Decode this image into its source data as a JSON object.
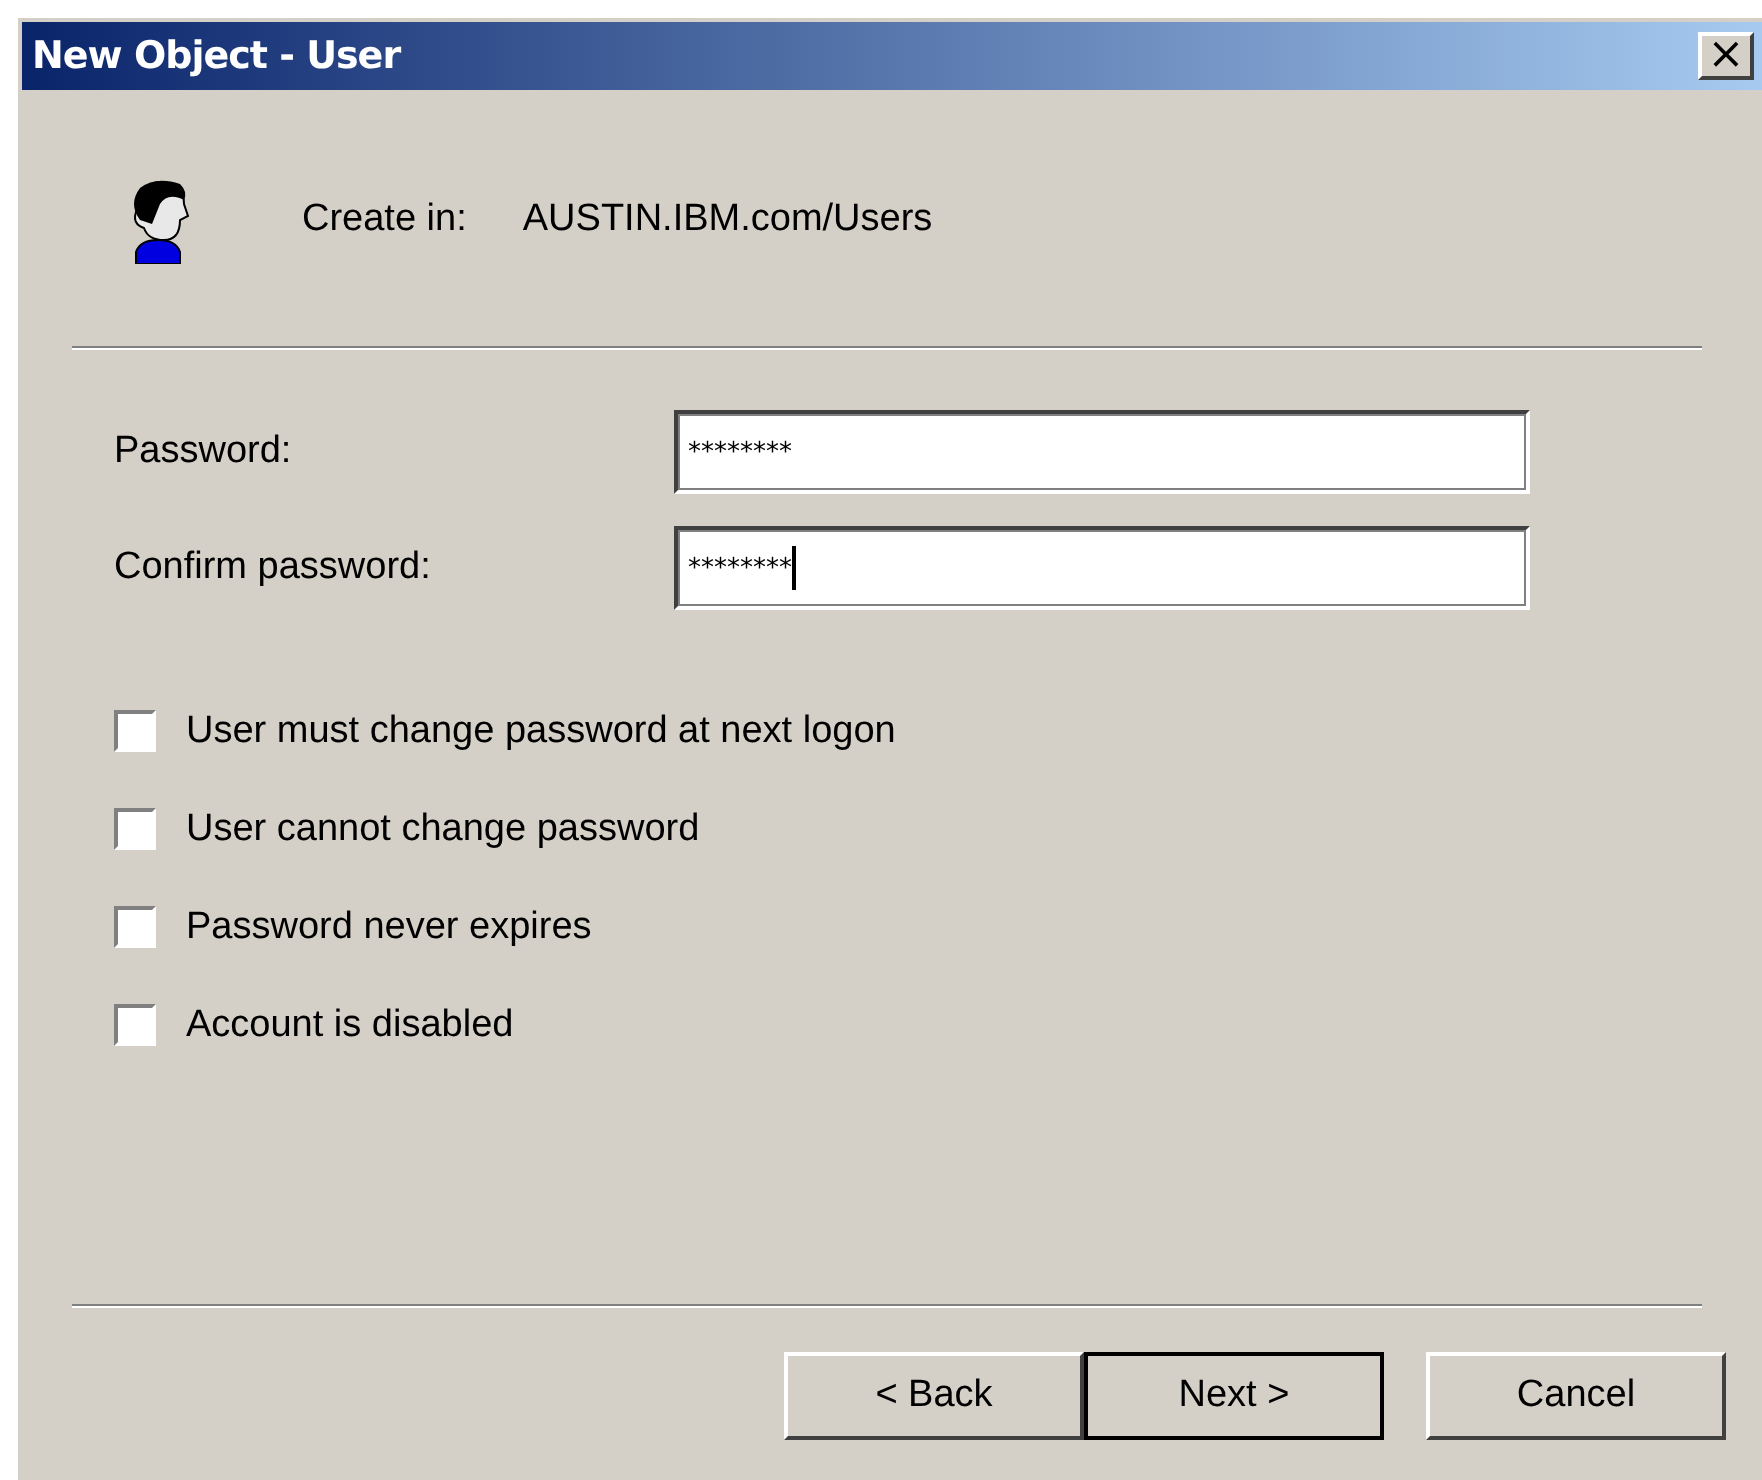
{
  "window": {
    "title": "New Object - User",
    "close": "×"
  },
  "header": {
    "label": "Create in:",
    "value": "AUSTIN.IBM.com/Users"
  },
  "fields": [
    {
      "label": "Password:",
      "value": "********",
      "focused": false
    },
    {
      "label": "Confirm password:",
      "value": "********",
      "focused": true
    }
  ],
  "options": [
    {
      "label": "User must change password at next logon",
      "checked": false
    },
    {
      "label": "User cannot change password",
      "checked": false
    },
    {
      "label": "Password never expires",
      "checked": false
    },
    {
      "label": "Account is disabled",
      "checked": false
    }
  ],
  "buttons": [
    {
      "label": "< Back",
      "default": false
    },
    {
      "label": "Next >",
      "default": true
    },
    {
      "label": "Cancel",
      "default": false
    }
  ]
}
